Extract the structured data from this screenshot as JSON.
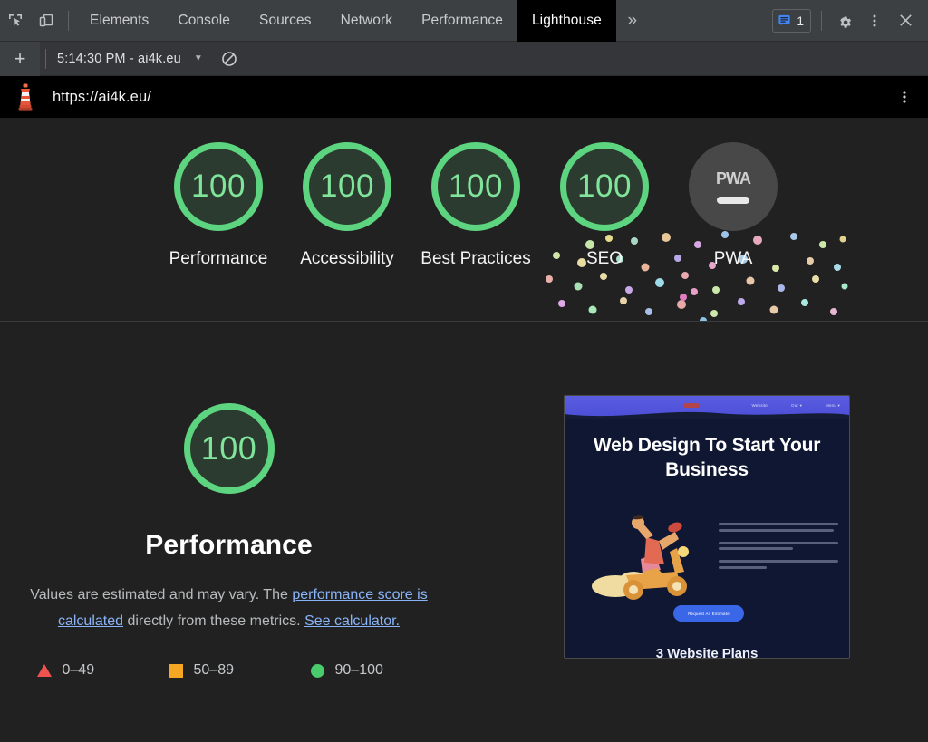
{
  "devtools": {
    "icons": {
      "inspect": "inspect-element-icon",
      "device": "device-toolbar-icon",
      "more_tabs": "»",
      "issues": "issues-icon",
      "settings": "gear-icon",
      "menu": "kebab-menu-icon",
      "close": "close-icon"
    },
    "tabs": [
      {
        "label": "Elements",
        "selected": false
      },
      {
        "label": "Console",
        "selected": false
      },
      {
        "label": "Sources",
        "selected": false
      },
      {
        "label": "Network",
        "selected": false
      },
      {
        "label": "Performance",
        "selected": false
      },
      {
        "label": "Lighthouse",
        "selected": true
      }
    ],
    "issues_count": "1"
  },
  "run_bar": {
    "new_report_label": "+",
    "selected_run": "5:14:30 PM - ai4k.eu",
    "dropdown_caret": "▼",
    "clear_label": "clear-icon"
  },
  "report_header": {
    "url": "https://ai4k.eu/",
    "logo": "lighthouse-logo",
    "menu": "kebab-menu-icon"
  },
  "scores": [
    {
      "label": "Performance",
      "value": "100",
      "type": "gauge"
    },
    {
      "label": "Accessibility",
      "value": "100",
      "type": "gauge"
    },
    {
      "label": "Best Practices",
      "value": "100",
      "type": "gauge"
    },
    {
      "label": "SEO",
      "value": "100",
      "type": "gauge"
    },
    {
      "label": "PWA",
      "value": "PWA",
      "type": "badge"
    }
  ],
  "performance": {
    "score": "100",
    "title": "Performance",
    "description_part1": "Values are estimated and may vary. The ",
    "link1": "performance score is calculated",
    "description_part2": " directly from these metrics. ",
    "link2": "See calculator.",
    "legend": [
      {
        "shape": "triangle",
        "range": "0–49",
        "color": "#ef5350"
      },
      {
        "shape": "square",
        "range": "50–89",
        "color": "#f5a623"
      },
      {
        "shape": "circle",
        "range": "90–100",
        "color": "#49cc6c"
      }
    ]
  },
  "screenshot": {
    "nav_items": [
      "Website",
      "Our ▾",
      "Menu ▾"
    ],
    "heading": "Web Design To Start Your Business",
    "cta_label": "Request An Estimate",
    "section_heading": "3 Website Plans"
  },
  "colors": {
    "pass_green": "#5dd47f",
    "pass_green_text": "#80e49a",
    "average_orange": "#f5a623",
    "fail_red": "#ef5350",
    "link_blue": "#8ab4f8",
    "panel_bg": "#212121",
    "toolbar_bg": "#3c4043"
  }
}
